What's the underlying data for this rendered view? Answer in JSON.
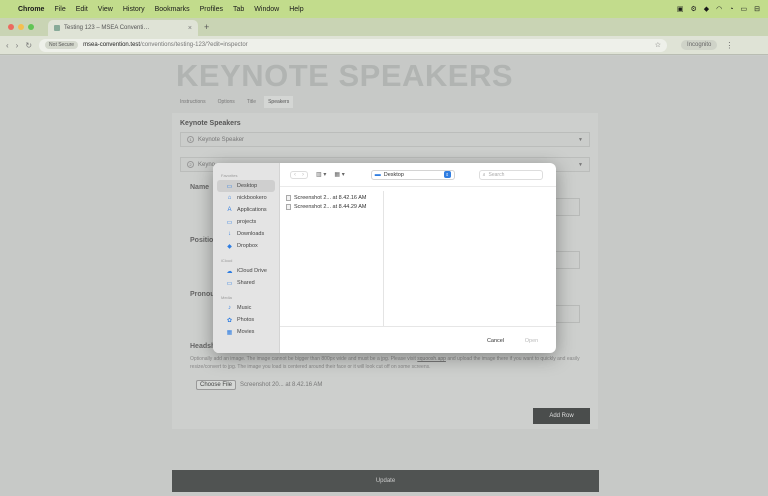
{
  "menubar": {
    "items": [
      "Chrome",
      "File",
      "Edit",
      "View",
      "History",
      "Bookmarks",
      "Profiles",
      "Tab",
      "Window",
      "Help"
    ]
  },
  "browser": {
    "tab_title": "Testing 123 – MSEA Conventi…",
    "security_badge": "Not Secure",
    "url_host": "msea-convention.test",
    "url_path": "/conventions/testing-123/?edit=inspector",
    "incognito_label": "Incognito"
  },
  "page": {
    "heading": "KEYNOTE SPEAKERS",
    "tabs": [
      "Instructions",
      "Options",
      "Title",
      "Speakers"
    ],
    "section_title": "Keynote Speakers",
    "accordion": [
      {
        "num": "1",
        "label": "Keynote Speaker"
      },
      {
        "num": "2",
        "label": "Keyno"
      }
    ],
    "fields": [
      "Name",
      "Position",
      "Pronou",
      "Headsh"
    ],
    "help_text": "Optionally add an image. The image cannot be bigger than 800px wide and must be a jpg. Please visit",
    "help_link": "squoosh.app",
    "help_text2": "and upload the image there if you want to quickly and easily resize/convert to jpg. The image you load is centered around their face or it will look cut off on some screens.",
    "choose_file": "Choose File",
    "chosen_file": "Screenshot 20... at 8.42.16 AM",
    "add_row": "Add Row",
    "update": "Update"
  },
  "dialog": {
    "sidebar": {
      "favorites_label": "Favorites",
      "favorites": [
        {
          "icon": "desktop-icon",
          "glyph": "▭",
          "label": "Desktop"
        },
        {
          "icon": "home-icon",
          "glyph": "⌂",
          "label": "nickbookero"
        },
        {
          "icon": "applications-icon",
          "glyph": "A",
          "label": "Applications"
        },
        {
          "icon": "folder-icon",
          "glyph": "▭",
          "label": "projects"
        },
        {
          "icon": "downloads-icon",
          "glyph": "↓",
          "label": "Downloads"
        },
        {
          "icon": "dropbox-icon",
          "glyph": "◆",
          "label": "Dropbox"
        }
      ],
      "icloud_label": "iCloud",
      "icloud": [
        {
          "icon": "icloud-icon",
          "glyph": "☁",
          "label": "iCloud Drive"
        },
        {
          "icon": "shared-folder-icon",
          "glyph": "▭",
          "label": "Shared"
        }
      ],
      "media_label": "Media",
      "media": [
        {
          "icon": "music-icon",
          "glyph": "♪",
          "label": "Music"
        },
        {
          "icon": "photos-icon",
          "glyph": "✿",
          "label": "Photos"
        },
        {
          "icon": "movies-icon",
          "glyph": "▦",
          "label": "Movies"
        }
      ]
    },
    "location": "Desktop",
    "search_placeholder": "Search",
    "files": [
      "Screenshot 2... at 8.42.16 AM",
      "Screenshot 2... at 8.44.29 AM"
    ],
    "cancel": "Cancel",
    "open": "Open"
  }
}
